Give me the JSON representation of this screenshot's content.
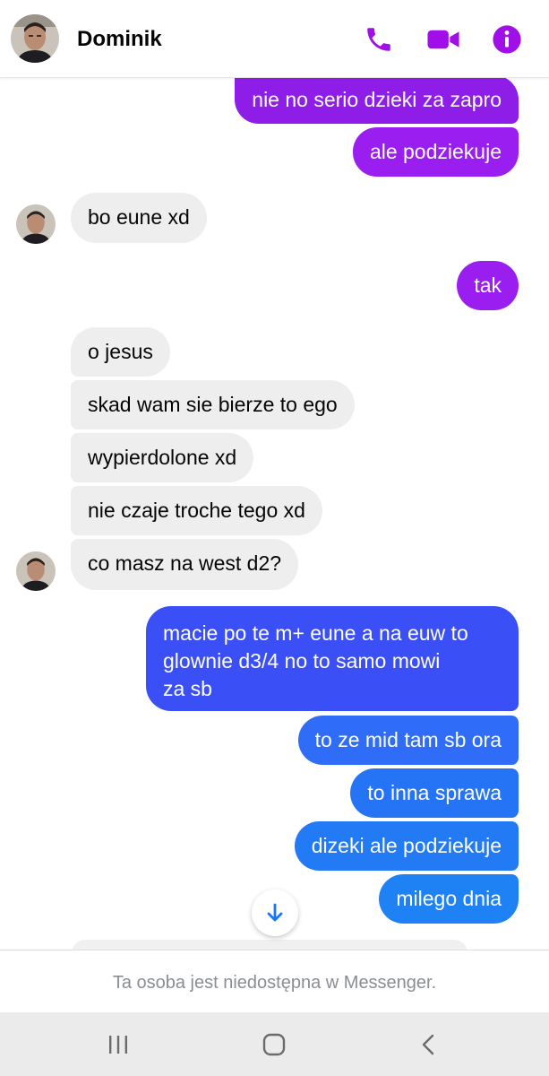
{
  "header": {
    "contact_name": "Dominik",
    "accent_color": "#a10fe8",
    "avatar_icon": "contact-avatar",
    "call_icon": "phone-icon",
    "video_icon": "video-camera-icon",
    "info_icon": "info-icon"
  },
  "messages": [
    {
      "direction": "out",
      "text": "nie no serio dzieki za zapro",
      "color": "#8f1de8"
    },
    {
      "direction": "out",
      "text": "ale podziekuje",
      "color": "#9a1ef0"
    },
    {
      "direction": "in",
      "text": "bo eune xd",
      "avatar": true
    },
    {
      "direction": "out",
      "text": "tak",
      "color": "#9a1ef0"
    },
    {
      "direction": "in",
      "text": "o jesus"
    },
    {
      "direction": "in",
      "text": "skad wam sie bierze to ego"
    },
    {
      "direction": "in",
      "text": "wypierdolone xd"
    },
    {
      "direction": "in",
      "text": "nie czaje troche tego xd"
    },
    {
      "direction": "in",
      "text": "co masz na west d2?",
      "avatar": true
    },
    {
      "direction": "out",
      "text": "macie po te m+ eune a na euw to\nglownie d3/4 no to samo mowi\nza sb",
      "color": "#3a4ff5"
    },
    {
      "direction": "out",
      "text": "to ze mid tam sb ora",
      "color": "#2f6cf8"
    },
    {
      "direction": "out",
      "text": "to inna sprawa",
      "color": "#2674f6"
    },
    {
      "direction": "out",
      "text": "dizeki ale podziekuje",
      "color": "#227bf5"
    },
    {
      "direction": "out",
      "text": "milego dnia",
      "color": "#1f82f4"
    }
  ],
  "scroll_button_icon": "arrow-down-icon",
  "footer": {
    "notice": "Ta osoba jest niedostępna w Messenger."
  },
  "navbar": {
    "recents_icon": "recents-icon",
    "home_icon": "home-icon",
    "back_icon": "back-icon"
  },
  "colors": {
    "incoming_bubble": "#eeeeee",
    "incoming_text": "#050505",
    "outgoing_text": "#ffffff",
    "scroll_arrow": "#1877f2"
  }
}
